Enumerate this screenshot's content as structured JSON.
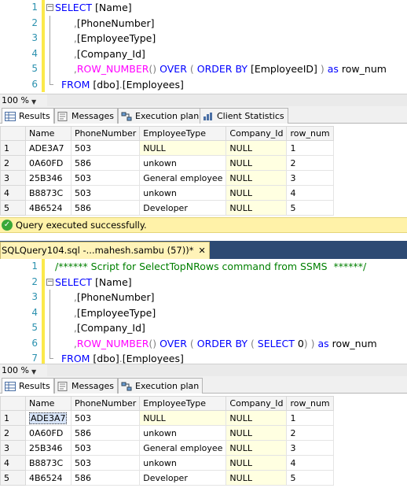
{
  "editor1": {
    "lines": [
      {
        "n": "1",
        "parts": [
          {
            "c": "kw",
            "t": "SELECT"
          },
          {
            "c": "bk",
            "t": " [Name]"
          }
        ]
      },
      {
        "n": "2",
        "parts": [
          {
            "c": "gr",
            "t": "      ,"
          },
          {
            "c": "bk",
            "t": "[PhoneNumber]"
          }
        ]
      },
      {
        "n": "3",
        "parts": [
          {
            "c": "gr",
            "t": "      ,"
          },
          {
            "c": "bk",
            "t": "[EmployeeType]"
          }
        ]
      },
      {
        "n": "4",
        "parts": [
          {
            "c": "gr",
            "t": "      ,"
          },
          {
            "c": "bk",
            "t": "[Company_Id]"
          }
        ]
      },
      {
        "n": "5",
        "parts": [
          {
            "c": "gr",
            "t": "      ,"
          },
          {
            "c": "fn",
            "t": "ROW_NUMBER"
          },
          {
            "c": "gr",
            "t": "() "
          },
          {
            "c": "kw",
            "t": "OVER"
          },
          {
            "c": "gr",
            "t": " ( "
          },
          {
            "c": "kw",
            "t": "ORDER BY"
          },
          {
            "c": "bk",
            "t": " [EmployeeID] "
          },
          {
            "c": "gr",
            "t": ") "
          },
          {
            "c": "kw",
            "t": "as"
          },
          {
            "c": "bk",
            "t": " row_num"
          }
        ]
      },
      {
        "n": "6",
        "parts": [
          {
            "c": "bk",
            "t": "  "
          },
          {
            "c": "kw",
            "t": "FROM"
          },
          {
            "c": "bk",
            "t": " [dbo]"
          },
          {
            "c": "gr",
            "t": "."
          },
          {
            "c": "bk",
            "t": "[Employees]"
          }
        ]
      }
    ]
  },
  "editor2": {
    "lines": [
      {
        "n": "1",
        "parts": [
          {
            "c": "cm",
            "t": "/****** Script for SelectTopNRows command from SSMS  ******/"
          }
        ]
      },
      {
        "n": "2",
        "parts": [
          {
            "c": "kw",
            "t": "SELECT"
          },
          {
            "c": "bk",
            "t": " [Name]"
          }
        ]
      },
      {
        "n": "3",
        "parts": [
          {
            "c": "gr",
            "t": "      ,"
          },
          {
            "c": "bk",
            "t": "[PhoneNumber]"
          }
        ]
      },
      {
        "n": "4",
        "parts": [
          {
            "c": "gr",
            "t": "      ,"
          },
          {
            "c": "bk",
            "t": "[EmployeeType]"
          }
        ]
      },
      {
        "n": "5",
        "parts": [
          {
            "c": "gr",
            "t": "      ,"
          },
          {
            "c": "bk",
            "t": "[Company_Id]"
          }
        ]
      },
      {
        "n": "6",
        "parts": [
          {
            "c": "gr",
            "t": "      ,"
          },
          {
            "c": "fn",
            "t": "ROW_NUMBER"
          },
          {
            "c": "gr",
            "t": "() "
          },
          {
            "c": "kw",
            "t": "OVER"
          },
          {
            "c": "gr",
            "t": " ( "
          },
          {
            "c": "kw",
            "t": "ORDER BY"
          },
          {
            "c": "gr",
            "t": " ( "
          },
          {
            "c": "kw",
            "t": "SELECT"
          },
          {
            "c": "bk",
            "t": " 0"
          },
          {
            "c": "gr",
            "t": ") ) "
          },
          {
            "c": "kw",
            "t": "as"
          },
          {
            "c": "bk",
            "t": " row_num"
          }
        ]
      },
      {
        "n": "7",
        "parts": [
          {
            "c": "bk",
            "t": "  "
          },
          {
            "c": "kw",
            "t": "FROM"
          },
          {
            "c": "bk",
            "t": " [dbo]"
          },
          {
            "c": "gr",
            "t": "."
          },
          {
            "c": "bk",
            "t": "[Employees]"
          }
        ]
      }
    ]
  },
  "zoom1": "100 %",
  "zoom2": "100 %",
  "tabs1": {
    "results": "Results",
    "messages": "Messages",
    "execution_plan": "Execution plan",
    "client_statistics": "Client Statistics"
  },
  "tabs2": {
    "results": "Results",
    "messages": "Messages",
    "execution_plan": "Execution plan"
  },
  "grid": {
    "columns": [
      "Name",
      "PhoneNumber",
      "EmployeeType",
      "Company_Id",
      "row_num"
    ],
    "rows1": [
      [
        "1",
        "ADE3A7",
        "503",
        "NULL",
        "NULL",
        "1"
      ],
      [
        "2",
        "0A60FD",
        "586",
        "unkown",
        "NULL",
        "2"
      ],
      [
        "3",
        "25B346",
        "503",
        "General employee",
        "NULL",
        "3"
      ],
      [
        "4",
        "B8873C",
        "503",
        "unkown",
        "NULL",
        "4"
      ],
      [
        "5",
        "4B6524",
        "586",
        "Developer",
        "NULL",
        "5"
      ]
    ],
    "rows2": [
      [
        "1",
        "ADE3A7",
        "503",
        "NULL",
        "NULL",
        "1"
      ],
      [
        "2",
        "0A60FD",
        "586",
        "unkown",
        "NULL",
        "2"
      ],
      [
        "3",
        "25B346",
        "503",
        "General employee",
        "NULL",
        "3"
      ],
      [
        "4",
        "B8873C",
        "503",
        "unkown",
        "NULL",
        "4"
      ],
      [
        "5",
        "4B6524",
        "586",
        "Developer",
        "NULL",
        "5"
      ]
    ]
  },
  "status": "Query executed successfully.",
  "doc_tab": {
    "title": "SQLQuery104.sql -...mahesh.sambu (57))*",
    "close": "✕"
  }
}
